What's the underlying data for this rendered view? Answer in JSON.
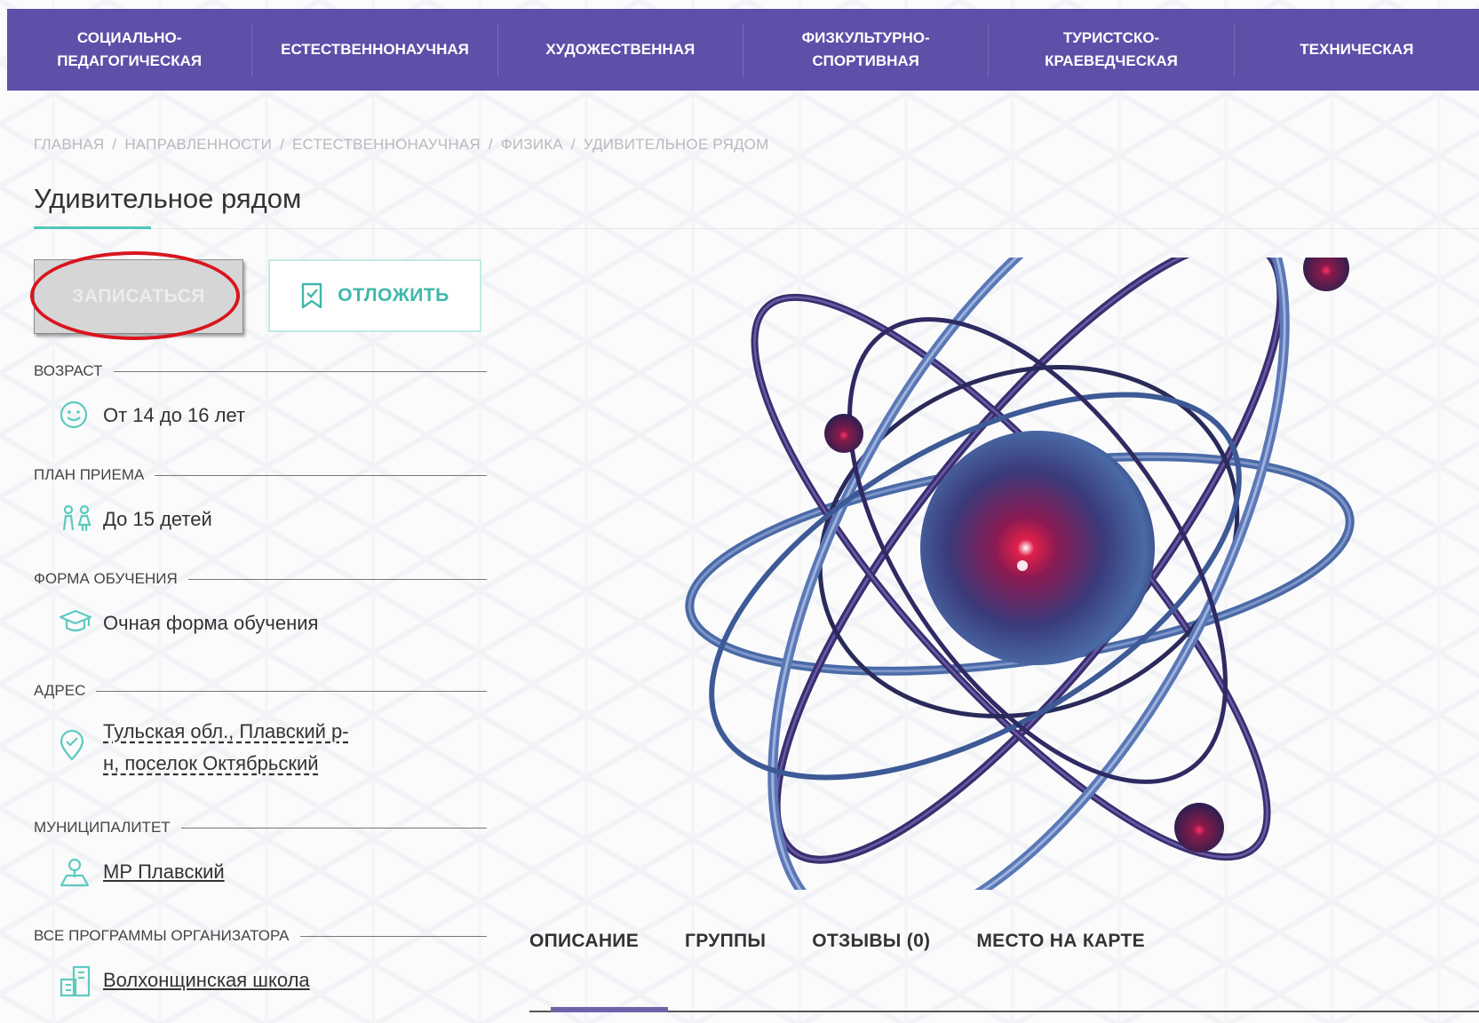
{
  "topnav": {
    "items": [
      {
        "lines": [
          "СОЦИАЛЬНО-",
          "ПЕДАГОГИЧЕСКАЯ"
        ]
      },
      {
        "lines": [
          "ЕСТЕСТВЕННОНАУЧНАЯ"
        ]
      },
      {
        "lines": [
          "ХУДОЖЕСТВЕННАЯ"
        ]
      },
      {
        "lines": [
          "ФИЗКУЛЬТУРНО-",
          "СПОРТИВНАЯ"
        ]
      },
      {
        "lines": [
          "ТУРИСТСКО-",
          "КРАЕВЕДЧЕСКАЯ"
        ]
      },
      {
        "lines": [
          "ТЕХНИЧЕСКАЯ"
        ]
      }
    ]
  },
  "breadcrumb": {
    "items": [
      "ГЛАВНАЯ",
      "НАПРАВЛЕННОСТИ",
      "ЕСТЕСТВЕННОНАУЧНАЯ",
      "ФИЗИКА",
      "УДИВИТЕЛЬНОЕ РЯДОМ"
    ],
    "separator": "/"
  },
  "page": {
    "title": "Удивительное рядом"
  },
  "actions": {
    "enroll_label": "ЗАПИСАТЬСЯ",
    "postpone_label": "ОТЛОЖИТЬ"
  },
  "info": {
    "age": {
      "label": "ВОЗРАСТ",
      "value": "От 14 до 16 лет",
      "icon": "smile-icon"
    },
    "plan": {
      "label": "ПЛАН ПРИЕМА",
      "value": "До 15 детей",
      "icon": "children-icon"
    },
    "form": {
      "label": "ФОРМА ОБУЧЕНИЯ",
      "value": "Очная форма обучения",
      "icon": "graduation-cap-icon"
    },
    "address": {
      "label": "АДРЕС",
      "line1": "Тульская обл., Плавский р-",
      "line2": "н, поселок Октябрьский",
      "icon": "location-check-icon"
    },
    "municipality": {
      "label": "МУНИЦИПАЛИТЕТ",
      "value": "МР Плавский",
      "icon": "map-person-icon"
    },
    "organizer": {
      "label": "ВСЕ ПРОГРАММЫ ОРГАНИЗАТОРА",
      "value": "Волхонщинская школа",
      "icon": "building-icon"
    }
  },
  "tabs": [
    "ОПИСАНИЕ",
    "ГРУППЫ",
    "ОТЗЫВЫ (0)",
    "МЕСТО НА КАРТЕ"
  ],
  "colors": {
    "nav_bg": "#5e4fa8",
    "accent_teal": "#4fc6b9",
    "highlight_red": "#d8151e",
    "tab_active": "#6e63a8"
  }
}
